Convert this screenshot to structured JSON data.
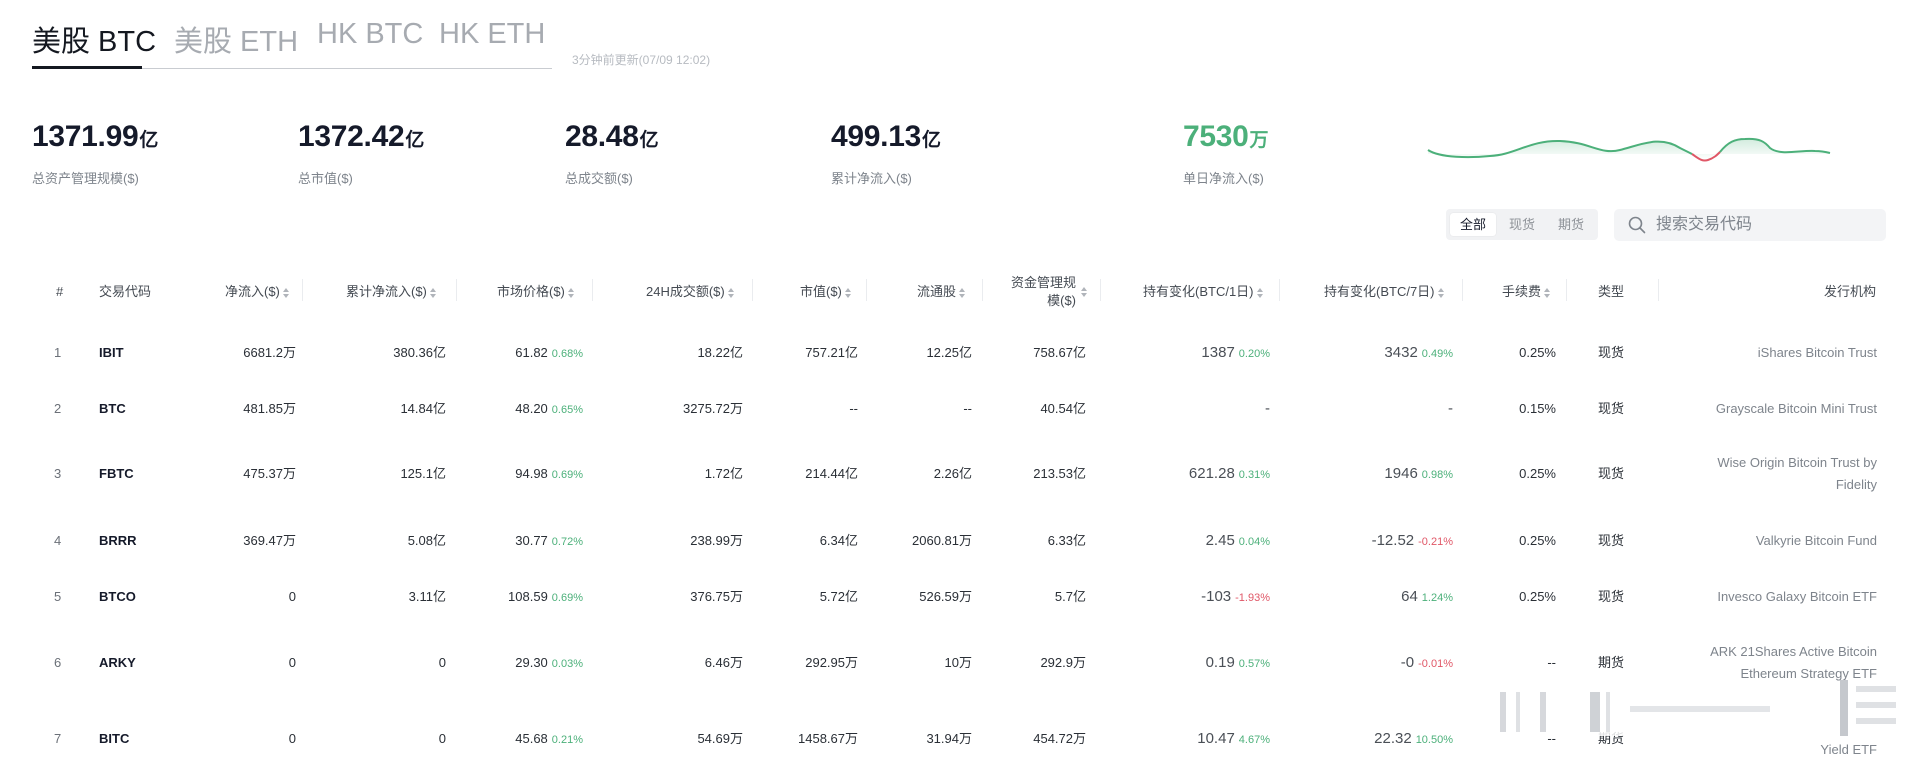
{
  "tabs": [
    "美股 BTC",
    "美股 ETH",
    "HK BTC",
    "HK ETH"
  ],
  "update_time": "3分钟前更新(07/09 12:02)",
  "stats": [
    {
      "value": "1371.99",
      "unit": "亿",
      "label": "总资产管理规模($)"
    },
    {
      "value": "1372.42",
      "unit": "亿",
      "label": "总市值($)"
    },
    {
      "value": "28.48",
      "unit": "亿",
      "label": "总成交额($)"
    },
    {
      "value": "499.13",
      "unit": "亿",
      "label": "累计净流入($)"
    },
    {
      "value": "7530",
      "unit": "万",
      "label": "单日净流入($)"
    }
  ],
  "colors": {
    "positive": "#4cb07a",
    "negative": "#e05767",
    "text": "#151a2a"
  },
  "filter": {
    "all": "全部",
    "spot": "现货",
    "futures": "期货"
  },
  "search": {
    "placeholder": "搜索交易代码"
  },
  "table": {
    "headers": {
      "index": "#",
      "code": "交易代码",
      "net_inflow": "净流入($)",
      "cum_inflow": "累计净流入($)",
      "price": "市场价格($)",
      "volume": "24H成交额($)",
      "mcap": "市值($)",
      "float": "流通股",
      "aum_line1": "资金管理规",
      "aum_line2": "模($)",
      "hold_1d": "持有变化(BTC/1日)",
      "hold_7d": "持有变化(BTC/7日)",
      "fee": "手续费",
      "type": "类型",
      "issuer": "发行机构"
    },
    "rows": [
      {
        "index": "1",
        "code": "IBIT",
        "net_inflow": "6681.2万",
        "cum_inflow": "380.36亿",
        "price": "61.82",
        "price_chg": "0.68%",
        "volume": "18.22亿",
        "mcap": "757.21亿",
        "float": "12.25亿",
        "aum": "758.67亿",
        "hold_1d": "1387",
        "hold_1d_pct": "0.20%",
        "hold_7d": "3432",
        "hold_7d_pct": "0.49%",
        "fee": "0.25%",
        "type": "现货",
        "issuer": "iShares Bitcoin Trust"
      },
      {
        "index": "2",
        "code": "BTC",
        "net_inflow": "481.85万",
        "cum_inflow": "14.84亿",
        "price": "48.20",
        "price_chg": "0.65%",
        "volume": "3275.72万",
        "mcap": "--",
        "float": "--",
        "aum": "40.54亿",
        "hold_1d": "-",
        "hold_1d_pct": "",
        "hold_7d": "-",
        "hold_7d_pct": "",
        "fee": "0.15%",
        "type": "现货",
        "issuer": "Grayscale Bitcoin Mini Trust"
      },
      {
        "index": "3",
        "code": "FBTC",
        "net_inflow": "475.37万",
        "cum_inflow": "125.1亿",
        "price": "94.98",
        "price_chg": "0.69%",
        "volume": "1.72亿",
        "mcap": "214.44亿",
        "float": "2.26亿",
        "aum": "213.53亿",
        "hold_1d": "621.28",
        "hold_1d_pct": "0.31%",
        "hold_7d": "1946",
        "hold_7d_pct": "0.98%",
        "fee": "0.25%",
        "type": "现货",
        "issuer": "Wise Origin Bitcoin Trust by Fidelity"
      },
      {
        "index": "4",
        "code": "BRRR",
        "net_inflow": "369.47万",
        "cum_inflow": "5.08亿",
        "price": "30.77",
        "price_chg": "0.72%",
        "volume": "238.99万",
        "mcap": "6.34亿",
        "float": "2060.81万",
        "aum": "6.33亿",
        "hold_1d": "2.45",
        "hold_1d_pct": "0.04%",
        "hold_7d": "-12.52",
        "hold_7d_pct": "-0.21%",
        "fee": "0.25%",
        "type": "现货",
        "issuer": "Valkyrie Bitcoin Fund"
      },
      {
        "index": "5",
        "code": "BTCO",
        "net_inflow": "0",
        "cum_inflow": "3.11亿",
        "price": "108.59",
        "price_chg": "0.69%",
        "volume": "376.75万",
        "mcap": "5.72亿",
        "float": "526.59万",
        "aum": "5.7亿",
        "hold_1d": "-103",
        "hold_1d_pct": "-1.93%",
        "hold_7d": "64",
        "hold_7d_pct": "1.24%",
        "fee": "0.25%",
        "type": "现货",
        "issuer": "Invesco Galaxy Bitcoin ETF"
      },
      {
        "index": "6",
        "code": "ARKY",
        "net_inflow": "0",
        "cum_inflow": "0",
        "price": "29.30",
        "price_chg": "0.03%",
        "volume": "6.46万",
        "mcap": "292.95万",
        "float": "10万",
        "aum": "292.9万",
        "hold_1d": "0.19",
        "hold_1d_pct": "0.57%",
        "hold_7d": "-0",
        "hold_7d_pct": "-0.01%",
        "fee": "--",
        "type": "期货",
        "issuer": "ARK 21Shares Active Bitcoin Ethereum Strategy ETF"
      },
      {
        "index": "7",
        "code": "BITC",
        "net_inflow": "0",
        "cum_inflow": "0",
        "price": "45.68",
        "price_chg": "0.21%",
        "volume": "54.69万",
        "mcap": "1458.67万",
        "float": "31.94万",
        "aum": "454.72万",
        "hold_1d": "10.47",
        "hold_1d_pct": "4.67%",
        "hold_7d": "22.32",
        "hold_7d_pct": "10.50%",
        "fee": "--",
        "type": "期货",
        "issuer": "Yield ETF"
      }
    ]
  }
}
